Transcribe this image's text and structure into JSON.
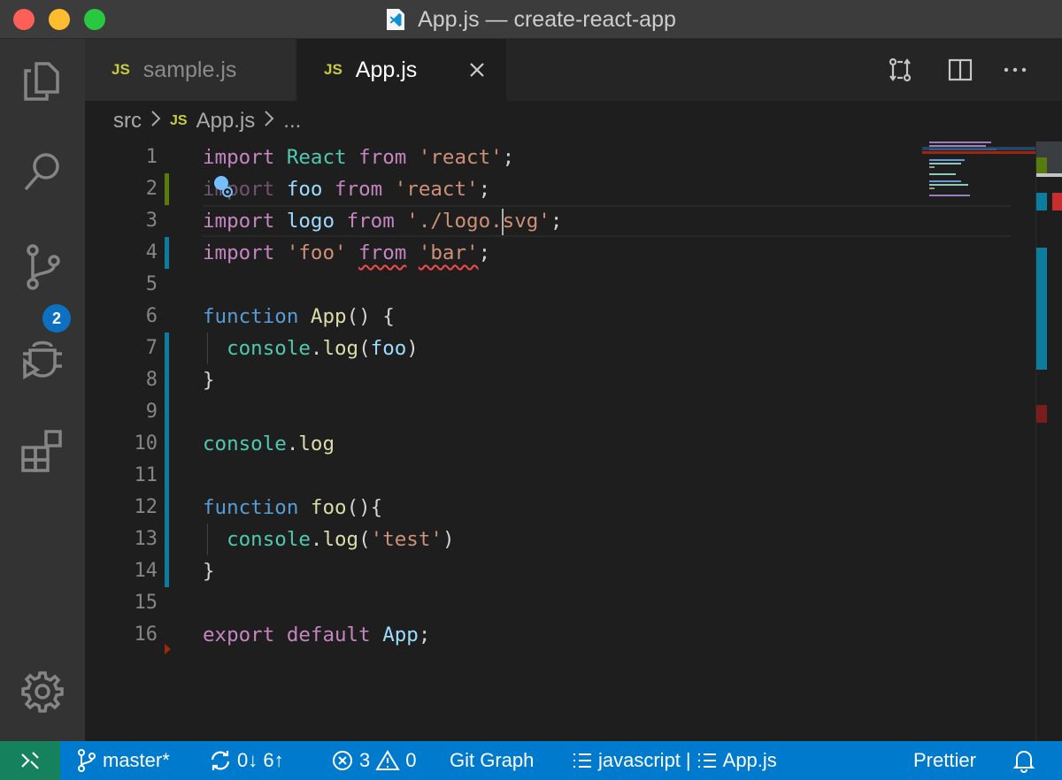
{
  "window": {
    "title": "App.js — create-react-app"
  },
  "activity_bar": {
    "scm_badge": "2"
  },
  "tabs": [
    {
      "badge": "JS",
      "label": "sample.js"
    },
    {
      "badge": "JS",
      "label": "App.js"
    }
  ],
  "breadcrumb": {
    "folder": "src",
    "badge": "JS",
    "file": "App.js",
    "more": "..."
  },
  "editor": {
    "line_numbers": [
      "1",
      "2",
      "3",
      "4",
      "5",
      "6",
      "7",
      "8",
      "9",
      "10",
      "11",
      "12",
      "13",
      "14",
      "15",
      "16"
    ],
    "lines": [
      [
        {
          "t": "import ",
          "c": "kw"
        },
        {
          "t": "React ",
          "c": "cls"
        },
        {
          "t": "from ",
          "c": "kw"
        },
        {
          "t": "'react'",
          "c": "str"
        },
        {
          "t": ";",
          "c": "pn"
        }
      ],
      [
        {
          "t": "import ",
          "c": "kw"
        },
        {
          "t": "foo ",
          "c": "id"
        },
        {
          "t": "from ",
          "c": "kw"
        },
        {
          "t": "'react'",
          "c": "str"
        },
        {
          "t": ";",
          "c": "pn"
        }
      ],
      [
        {
          "t": "import ",
          "c": "kw"
        },
        {
          "t": "logo ",
          "c": "id"
        },
        {
          "t": "from ",
          "c": "kw"
        },
        {
          "t": "'./logo.svg'",
          "c": "str"
        },
        {
          "t": ";",
          "c": "pn"
        }
      ],
      [
        {
          "t": "import ",
          "c": "kw"
        },
        {
          "t": "'foo' ",
          "c": "str"
        },
        {
          "t": "from",
          "c": "kw"
        },
        {
          "t": " ",
          "c": "pn"
        },
        {
          "t": "'bar'",
          "c": "str"
        },
        {
          "t": ";",
          "c": "pn"
        }
      ],
      [],
      [
        {
          "t": "function ",
          "c": "kwf"
        },
        {
          "t": "App",
          "c": "fn"
        },
        {
          "t": "() {",
          "c": "pn"
        }
      ],
      [
        {
          "t": "  console",
          "c": "cls"
        },
        {
          "t": ".",
          "c": "pn"
        },
        {
          "t": "log",
          "c": "fn"
        },
        {
          "t": "(",
          "c": "pn"
        },
        {
          "t": "foo",
          "c": "id"
        },
        {
          "t": ")",
          "c": "pn"
        }
      ],
      [
        {
          "t": "}",
          "c": "pn"
        }
      ],
      [],
      [
        {
          "t": "console",
          "c": "cls"
        },
        {
          "t": ".",
          "c": "pn"
        },
        {
          "t": "log",
          "c": "fn"
        }
      ],
      [],
      [
        {
          "t": "function ",
          "c": "kwf"
        },
        {
          "t": "foo",
          "c": "fn"
        },
        {
          "t": "(){",
          "c": "pn"
        }
      ],
      [
        {
          "t": "  console",
          "c": "cls"
        },
        {
          "t": ".",
          "c": "pn"
        },
        {
          "t": "log",
          "c": "fn"
        },
        {
          "t": "(",
          "c": "pn"
        },
        {
          "t": "'test'",
          "c": "str"
        },
        {
          "t": ")",
          "c": "pn"
        }
      ],
      [
        {
          "t": "}",
          "c": "pn"
        }
      ],
      [],
      [
        {
          "t": "export ",
          "c": "kw"
        },
        {
          "t": "default ",
          "c": "kw"
        },
        {
          "t": "App",
          "c": "id"
        },
        {
          "t": ";",
          "c": "pn"
        }
      ]
    ],
    "gutter_changes": [
      {
        "line": 2,
        "kind": "modified-green"
      },
      {
        "line": 4,
        "kind": "added"
      },
      {
        "line": 7,
        "kind": "added"
      },
      {
        "line": 8,
        "kind": "added"
      },
      {
        "line": 9,
        "kind": "added"
      },
      {
        "line": 10,
        "kind": "added"
      },
      {
        "line": 11,
        "kind": "added"
      },
      {
        "line": 12,
        "kind": "added"
      },
      {
        "line": 13,
        "kind": "added"
      },
      {
        "line": 14,
        "kind": "added"
      },
      {
        "line": 16,
        "kind": "deleted"
      }
    ],
    "colors": {
      "added": "#0c7d9d",
      "modified": "#587c0c",
      "deleted": "#a1260d"
    }
  },
  "statusbar": {
    "branch": "master*",
    "sync": "0↓ 6↑",
    "errors": "3",
    "warnings": "0",
    "git_graph": "Git Graph",
    "language": "javascript",
    "separator": "|",
    "file": "App.js",
    "formatter": "Prettier",
    "background": "#007acc",
    "remote_background": "#16825d"
  }
}
